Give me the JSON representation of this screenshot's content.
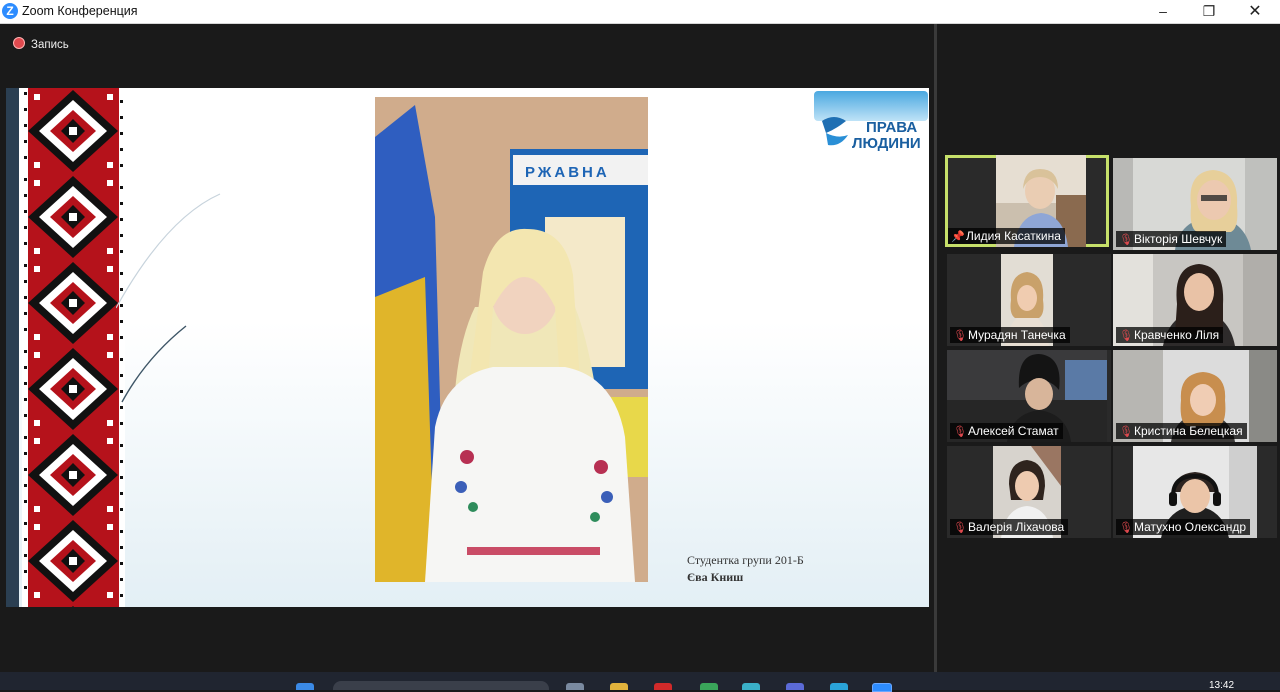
{
  "window": {
    "logo_letter": "Z",
    "title": "Zoom Конференция",
    "minimize": "–",
    "maximize": "❐",
    "close": "✕"
  },
  "recording": {
    "label": "Запись"
  },
  "slide": {
    "logo_line1": "ПРАВА",
    "logo_line2": "ЛЮДИНИ",
    "caption_line1": "Студентка групи 201-Б",
    "caption_line2": "Єва Книш",
    "banner_text": "РЖАВНА"
  },
  "participants": [
    {
      "name": "Лидия Касаткина",
      "icon": "pin-icon",
      "active": true
    },
    {
      "name": "Вікторія Шевчук",
      "icon": "mic-muted-icon"
    },
    {
      "name": "Мурадян Танечка",
      "icon": "mic-muted-icon"
    },
    {
      "name": "Кравченко Ліля",
      "icon": "mic-muted-icon"
    },
    {
      "name": "Алексей Стамат",
      "icon": "mic-muted-icon"
    },
    {
      "name": "Кристина Белецкая",
      "icon": "mic-muted-icon"
    },
    {
      "name": "Валерія Ліхачова",
      "icon": "mic-muted-icon"
    },
    {
      "name": "Матухно Олександр",
      "icon": "mic-muted-icon"
    }
  ],
  "taskbar": {
    "time": "13:42"
  },
  "colors": {
    "active_speaker": "#c6e06a",
    "muted": "#e0494e",
    "zoom_blue": "#2d8cff"
  }
}
